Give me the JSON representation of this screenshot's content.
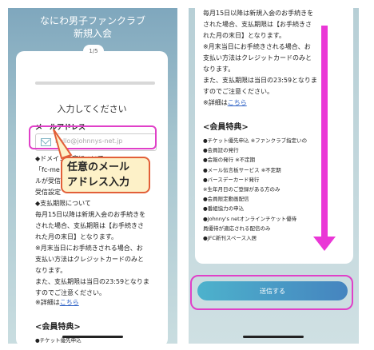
{
  "left": {
    "title_line1": "なにわ男子ファンクラブ",
    "title_line2": "新規入会",
    "step": "1/5",
    "heading": "入力してください",
    "email_label": "メールアドレス",
    "email_placeholder": "hello@johnnys-net.jp",
    "domain_note": "◆ドメイン指定について\n「fc-me\nルが受信\n受信設定",
    "payment_note": "◆支払期限について\n毎月15日以降は新規入会のお手続きを\nされた場合、支払期限は【お手続きさ\nれた月の末日】となります。\n※月末当日にお手続きされる場合、お\n支払い方法はクレジットカードのみと\nなります。\nまた、支払期限は当日の23:59となりま\nすのでご注意ください。",
    "details_prefix": "※詳細は",
    "details_link": "こちら",
    "benefits_heading": "<会員特典>",
    "benefit_peek": "●チケット優先申込"
  },
  "callout": {
    "line1": "任意のメール",
    "line2": "アドレス入力"
  },
  "right": {
    "payment_note": "毎月15日以降は新規入会のお手続きを\nされた場合、支払期限は【お手続きさ\nれた月の末日】となります。\n※月末当日にお手続きされる場合、お\n支払い方法はクレジットカードのみと\nなります。\nまた、支払期限は当日の23:59となりま\nすのでご注意ください。",
    "details_prefix": "※詳細は",
    "details_link": "こちら",
    "benefits_heading": "<会員特典>",
    "benefits": "●チケット優先申込 ※ファンクラブ指定いの\n●会員証の発行\n●会報の発行 ※不定期\n●メール伝言板サービス ※不定期\n●バースデーカード発行\n※生年月日のご登録がある方のみ\n●会員限定動画配信\n●番組協力の申込\n●Johnny's netオンラインチケット優待\n員優待が適応される配信のみ\n●JFC新刊スペース入居",
    "submit_label": "送信する"
  },
  "colors": {
    "highlight": "#e040c8",
    "arrow": "#ea37d6",
    "callout_border": "#e25f38",
    "callout_fill": "#fdf1c8"
  }
}
